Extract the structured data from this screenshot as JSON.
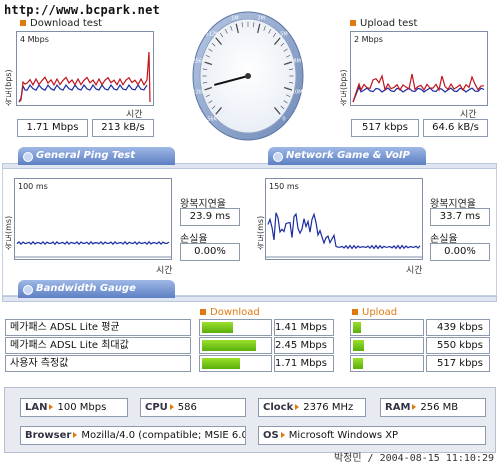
{
  "watermark_url": "http://www.bcpark.net",
  "download_test": {
    "title": "Download test",
    "y_axis_label": "속도(bps)",
    "top_label": "4 Mbps",
    "x_label": "시간",
    "value_mbps": "1.71 Mbps",
    "value_kBs": "213 kB/s"
  },
  "upload_test": {
    "title": "Upload test",
    "y_axis_label": "속도(bps)",
    "top_label": "2 Mbps",
    "x_label": "시간",
    "value_kbps": "517 kbps",
    "value_kBs": "64.6 kB/s"
  },
  "gauge": {
    "scale_labels": [
      "56K",
      "128K",
      "256K",
      "512K",
      "1M",
      "2M",
      "5M",
      "8M",
      "10M",
      "0"
    ],
    "needle_value_mbps": 1.71
  },
  "general_ping": {
    "tab_label": "General Ping Test",
    "y_axis_label": "속도(ms)",
    "top_label": "100 ms",
    "x_label": "시간",
    "rtt_label": "왕복지연율",
    "rtt_value": "23.9 ms",
    "loss_label": "손실율",
    "loss_value": "0.00%"
  },
  "game_voip": {
    "tab_label": "Network Game & VoIP Test",
    "y_axis_label": "속도(ms)",
    "top_label": "150 ms",
    "x_label": "시간",
    "rtt_label": "왕복지연율",
    "rtt_value": "33.7 ms",
    "loss_label": "손실율",
    "loss_value": "0.00%"
  },
  "bandwidth_gauge": {
    "tab_label": "Bandwidth Gauge",
    "download_header": "Download",
    "upload_header": "Upload",
    "rows": [
      {
        "label": "메가패스 ADSL Lite 평균",
        "download": "1.41 Mbps",
        "download_fill": 0.46,
        "upload": "439 kbps",
        "upload_fill": 0.12
      },
      {
        "label": "메가패스 ADSL Lite 최대값",
        "download": "2.45 Mbps",
        "download_fill": 0.8,
        "upload": "550 kbps",
        "upload_fill": 0.16
      },
      {
        "label": "사용자 측정값",
        "download": "1.71 Mbps",
        "download_fill": 0.56,
        "upload": "517 kbps",
        "upload_fill": 0.14
      }
    ]
  },
  "system_info": {
    "lan_key": "LAN",
    "lan_value": "100 Mbps",
    "cpu_key": "CPU",
    "cpu_value": "586",
    "clock_key": "Clock",
    "clock_value": "2376 MHz",
    "ram_key": "RAM",
    "ram_value": "256 MB",
    "browser_key": "Browser",
    "browser_value": "Mozilla/4.0 (compatible; MSIE 6.0",
    "os_key": "OS",
    "os_value": "Microsoft Windows XP"
  },
  "footer_text": "박정민 / 2004-08-15 11:10:29",
  "colors": {
    "download_line": "#c0141c",
    "upload_line": "#1a2ca0",
    "ping_line": "#1a2ca0",
    "bar_green": "#6cc414",
    "tab_blue": "#6d8ed0",
    "accent_orange": "#e07a10"
  }
}
